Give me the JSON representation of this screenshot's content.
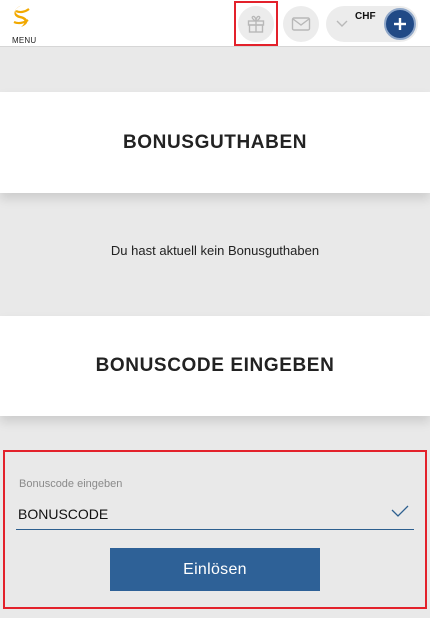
{
  "header": {
    "menu_label": "MENU",
    "currency": "CHF"
  },
  "icons": {
    "logo": "logo-icon",
    "gift": "gift-icon",
    "mail": "mail-icon",
    "chevron": "chevron-down-icon",
    "plus": "plus-icon",
    "check": "check-icon"
  },
  "colors": {
    "accent": "#2e6197",
    "brand_logo": "#f2a900",
    "highlight": "#e3212b",
    "plus_button": "#214a86"
  },
  "bonus_balance": {
    "title": "BONUSGUTHABEN",
    "empty_message": "Du hast aktuell kein Bonusguthaben"
  },
  "bonus_code": {
    "title": "BONUSCODE EINGEBEN",
    "field_label": "Bonuscode eingeben",
    "field_value": "BONUSCODE",
    "submit_label": "Einlösen"
  }
}
